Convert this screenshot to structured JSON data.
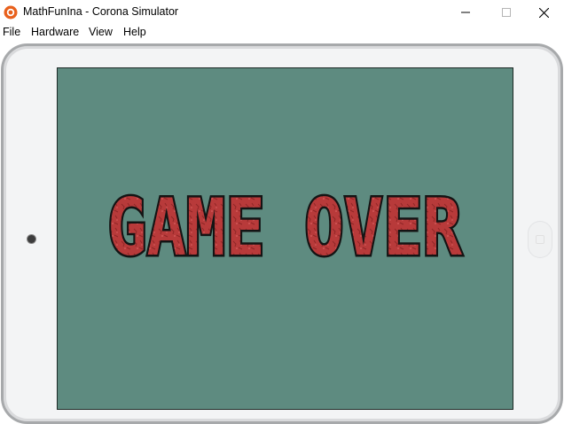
{
  "window": {
    "title": "MathFunIna - Corona Simulator",
    "icon": "corona-simulator-icon",
    "controls": [
      "minimize-icon",
      "maximize-icon",
      "close-icon"
    ]
  },
  "menubar": {
    "items": [
      {
        "label": "File"
      },
      {
        "label": "Hardware"
      },
      {
        "label": "View"
      },
      {
        "label": "Help"
      }
    ]
  },
  "device": {
    "type": "tablet-landscape",
    "screen_color": "#5e8b80",
    "frame_color": "#f3f4f5"
  },
  "game": {
    "headline": "GAME OVER",
    "headline_color": "#b83a3a"
  }
}
